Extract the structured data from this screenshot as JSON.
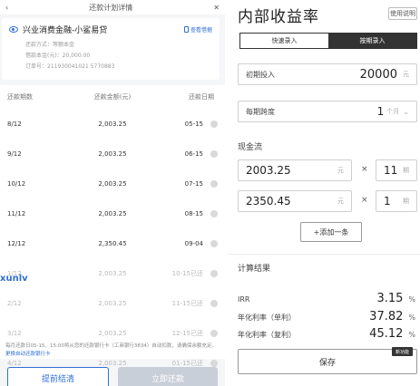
{
  "left": {
    "topbar_title": "还款计划详情",
    "loan_name": "兴业消费金融-小鲨易贷",
    "contract_link": "查看借据",
    "meta": [
      "还款方式：等额本金",
      "借款本金(元)：20,000.00",
      "订单号：211930041021 5770883"
    ],
    "table_headers": [
      "还款期数",
      "还款金额(元)",
      "还款日期"
    ],
    "rows": [
      {
        "period": "8/12",
        "amount": "2,003.25",
        "date": "05-15"
      },
      {
        "period": "9/12",
        "amount": "2,003.25",
        "date": "06-15"
      },
      {
        "period": "10/12",
        "amount": "2,003.25",
        "date": "07-15"
      },
      {
        "period": "11/12",
        "amount": "2,003.25",
        "date": "08-15"
      },
      {
        "period": "12/12",
        "amount": "2,350.45",
        "date": "09-04"
      },
      {
        "period": "1/12",
        "amount": "2,003.25",
        "date": "10-15已还"
      },
      {
        "period": "2/12",
        "amount": "2,003.25",
        "date": "11-15已还"
      },
      {
        "period": "3/12",
        "amount": "2,003.25",
        "date": "12-15已还"
      },
      {
        "period": "4/12",
        "amount": "2,003.25",
        "date": "01-15已还"
      }
    ],
    "watermark": "xunlv",
    "note_text": "每月还款日05-15，15:00将从您的还款银行卡（工商银行3834）自动扣款，请确保余额充足。",
    "note_link": "更换自动还款银行卡",
    "btn_prepay": "提前结清",
    "btn_repay": "立即还款"
  },
  "right": {
    "title": "内部收益率",
    "help_btn": "使用说明",
    "tab_quick": "快速录入",
    "tab_period": "按期录入",
    "initial_label": "初期投入",
    "initial_value": "20000",
    "initial_unit": "元",
    "span_label": "每期跨度",
    "span_value": "1",
    "span_unit": "个月",
    "cashflow_title": "现金流",
    "cashflows": [
      {
        "amount": "2003.25",
        "unit": "元",
        "times_sign": "×",
        "count": "11",
        "count_unit": "期"
      },
      {
        "amount": "2350.45",
        "unit": "元",
        "times_sign": "×",
        "count": "1",
        "count_unit": "期"
      }
    ],
    "add_btn": "+添加一条",
    "results_title": "计算结果",
    "results": [
      {
        "key": "IRR",
        "value": "3.15",
        "pct": "%"
      },
      {
        "key": "年化利率（单利）",
        "value": "37.82",
        "pct": "%"
      },
      {
        "key": "年化利率（复利）",
        "value": "45.12",
        "pct": "%"
      }
    ],
    "save_btn": "保存",
    "new_badge": "新功能"
  }
}
